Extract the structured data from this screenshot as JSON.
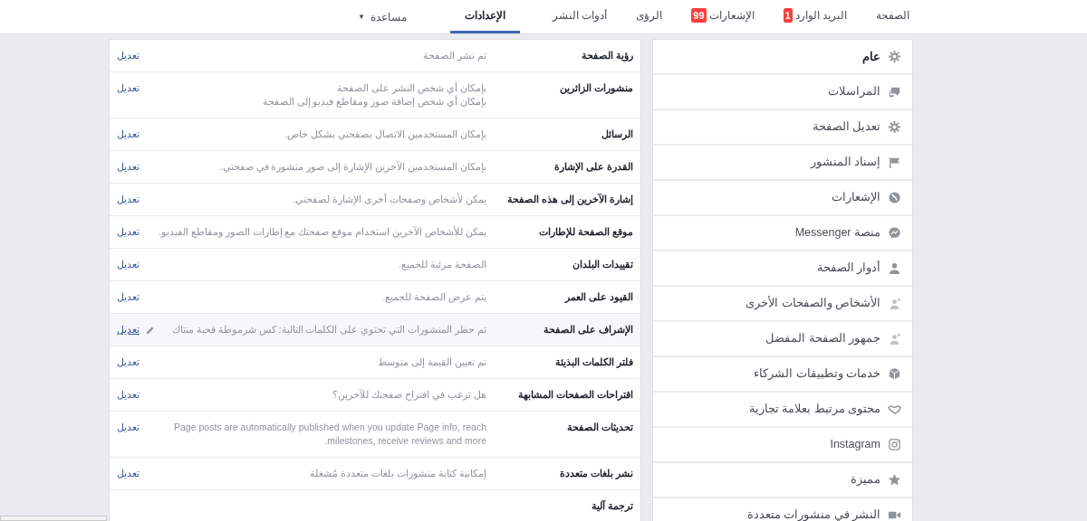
{
  "nav": {
    "items": [
      {
        "label": "الصفحة",
        "selected": false
      },
      {
        "label": "البريد الوارد",
        "badge": "1",
        "selected": false
      },
      {
        "label": "الإشعارات",
        "badge": "99",
        "selected": false
      },
      {
        "label": "الرؤى",
        "selected": false
      },
      {
        "label": "أدوات النشر",
        "selected": false
      },
      {
        "label": "الإعدادات",
        "selected": true
      }
    ],
    "help": {
      "label": "مساعدة",
      "caret": "▼"
    }
  },
  "sidebar": {
    "items": [
      {
        "label": "عام",
        "selected": true
      },
      {
        "label": "المراسلات",
        "selected": false
      },
      {
        "label": "تعديل الصفحة",
        "selected": false
      },
      {
        "label": "إسناد المنشور",
        "selected": false
      },
      {
        "label": "الإشعارات",
        "selected": false
      },
      {
        "label": "منصة Messenger",
        "selected": false
      },
      {
        "label": "أدوار الصفحة",
        "selected": false
      },
      {
        "label": "الأشخاص والصفحات الأخرى",
        "selected": false
      },
      {
        "label": "جمهور الصفحة المفضل",
        "selected": false
      },
      {
        "label": "خدمات وتطبيقات الشركاء",
        "selected": false
      },
      {
        "label": "محتوى مرتبط بعلامة تجارية",
        "selected": false
      },
      {
        "label": "Instagram",
        "selected": false
      },
      {
        "label": "مميزة",
        "selected": false
      },
      {
        "label": "النشر في منشورات متعددة",
        "selected": false
      }
    ]
  },
  "settings": {
    "rows": [
      {
        "label": "رؤية الصفحة",
        "value": [
          "تم نشر الصفحة"
        ],
        "edit": "تعديل",
        "highlighted": false
      },
      {
        "label": "منشورات الزائرين",
        "value": [
          "بإمكان أي شخص النشر على الصفحة",
          "بإمكان أي شخص إضافة صور ومقاطع فيديو إلى الصفحة"
        ],
        "edit": "تعديل",
        "highlighted": false
      },
      {
        "label": "الرسائل",
        "value": [
          "بإمكان المستخدمين الاتصال بصفحتي بشكل خاص."
        ],
        "edit": "تعديل",
        "highlighted": false
      },
      {
        "label": "القدرة على الإشارة",
        "value": [
          "بإمكان المستخدمين الآخرين الإشارة إلى صور منشورة في صفحتي."
        ],
        "edit": "تعديل",
        "highlighted": false
      },
      {
        "label": "إشارة الآخرين إلى هذه الصفحة",
        "value": [
          "يمكن لأشخاص وصفحات أخرى الإشارة لصفحتي."
        ],
        "edit": "تعديل",
        "highlighted": false
      },
      {
        "label": "موقع الصفحة للإطارات",
        "value": [
          "يمكن للأشخاص الآخرين استخدام موقع صفحتك مع إطارات الصور ومقاطع الفيديو."
        ],
        "edit": "تعديل",
        "highlighted": false
      },
      {
        "label": "تقييدات البلدان",
        "value": [
          "الصفحة مرئية للجميع."
        ],
        "edit": "تعديل",
        "highlighted": false
      },
      {
        "label": "القيود على العمر",
        "value": [
          "يتم عرض الصفحة للجميع."
        ],
        "edit": "تعديل",
        "highlighted": false
      },
      {
        "label": "الإشراف على الصفحة",
        "value": [
          "تم حظر المنشورات التي تحتوي على الكلمات التالية: كس شرموطة قحبة منتاك"
        ],
        "edit": "تعديل",
        "highlighted": true
      },
      {
        "label": "فلتر الكلمات البذيئة",
        "value": [
          "تم تعيين القيمة إلى متوسط"
        ],
        "edit": "تعديل",
        "highlighted": false
      },
      {
        "label": "اقتراحات الصفحات المشابهة",
        "value": [
          "هل ترغب في اقتراح صفحتك للآخرين؟"
        ],
        "edit": "تعديل",
        "highlighted": false
      },
      {
        "label": "تحديثات الصفحة",
        "value": [
          "Page posts are automatically published when you update Page info, reach milestones, receive reviews and more."
        ],
        "edit": "تعديل",
        "highlighted": false
      },
      {
        "label": "نشر بلغات متعددة",
        "value": [
          "إمكانية كتابة منشورات بلغات متعددة مُشغلة"
        ],
        "edit": "تعديل",
        "highlighted": false
      },
      {
        "label": "ترجمة آلية"
      }
    ]
  }
}
